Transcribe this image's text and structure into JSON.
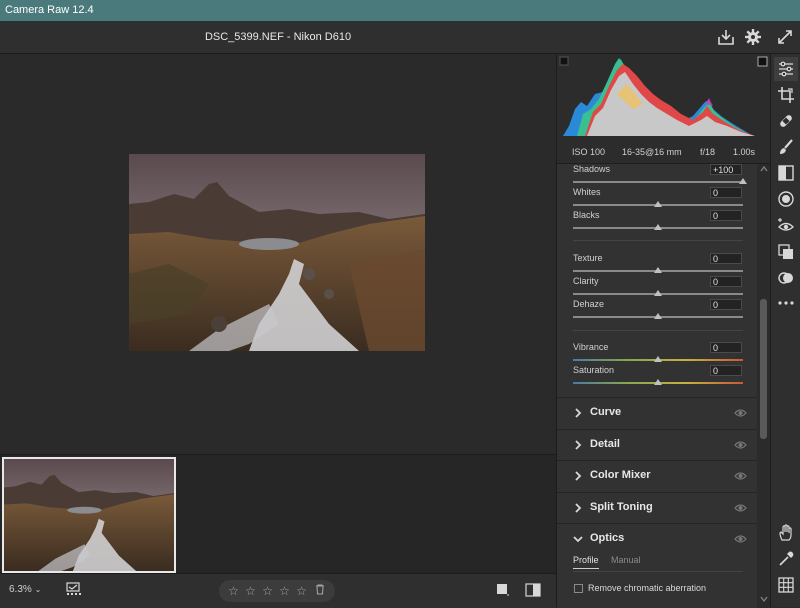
{
  "window": {
    "title": "Camera Raw 12.4"
  },
  "header": {
    "filename": "DSC_5399.NEF  -  Nikon D610",
    "save_icon": "save-icon",
    "settings_icon": "gear-icon",
    "fullscreen_icon": "expand-icon"
  },
  "exif": {
    "iso": "ISO 100",
    "lens": "16-35@16 mm",
    "aperture": "f/18",
    "shutter": "1.00s"
  },
  "sliders": [
    {
      "label": "Shadows",
      "value": "+100",
      "fraction": 1.0
    },
    {
      "label": "Whites",
      "value": "0",
      "fraction": 0.5
    },
    {
      "label": "Blacks",
      "value": "0",
      "fraction": 0.5
    },
    {
      "label": "Texture",
      "value": "0",
      "fraction": 0.5
    },
    {
      "label": "Clarity",
      "value": "0",
      "fraction": 0.5
    },
    {
      "label": "Dehaze",
      "value": "0",
      "fraction": 0.5
    },
    {
      "label": "Vibrance",
      "value": "0",
      "fraction": 0.5
    },
    {
      "label": "Saturation",
      "value": "0",
      "fraction": 0.5
    }
  ],
  "sections": {
    "curve": "Curve",
    "detail": "Detail",
    "color_mixer": "Color Mixer",
    "split_toning": "Split Toning",
    "optics": "Optics"
  },
  "optics": {
    "tab_profile": "Profile",
    "tab_manual": "Manual",
    "checkbox_label": "Remove chromatic aberration",
    "checked": false
  },
  "bottombar": {
    "zoom": "6.3%",
    "rating": 0,
    "rating_max": 5
  },
  "colors": {
    "titlebar": "#4a7a7c",
    "panel": "#323232",
    "canvas": "#2a2a2a"
  }
}
